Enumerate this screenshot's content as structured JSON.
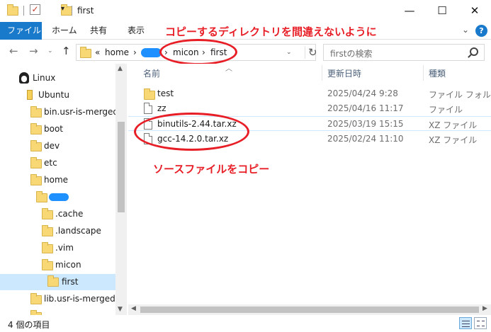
{
  "window": {
    "title": "first",
    "minimize": "—",
    "maximize": "☐",
    "close": "✕"
  },
  "ribbon": {
    "tabs": [
      "ファイル",
      "ホーム",
      "共有",
      "表示"
    ],
    "expand_icon": "chevron-down",
    "help": "?"
  },
  "annotations": {
    "copy_directory_note": "コピーするディレクトリを間違えないように",
    "copy_source_note": "ソースファイルをコピー"
  },
  "address_bar": {
    "overflow": "«",
    "crumbs": [
      "home",
      "micon",
      "first"
    ],
    "separator": "›",
    "redacted_crumb_color": "#1e90ff"
  },
  "search": {
    "placeholder": "firstの検索"
  },
  "nav_tree": [
    {
      "label": "Linux",
      "icon": "linux-icon"
    },
    {
      "label": "Ubuntu",
      "icon": "ubuntu-icon"
    },
    {
      "label": "bin.usr-is-merged",
      "icon": "folder-icon"
    },
    {
      "label": "boot",
      "icon": "folder-icon"
    },
    {
      "label": "dev",
      "icon": "folder-icon"
    },
    {
      "label": "etc",
      "icon": "folder-icon"
    },
    {
      "label": "home",
      "icon": "folder-icon"
    },
    {
      "label": "",
      "icon": "folder-icon",
      "redacted": true
    },
    {
      "label": ".cache",
      "icon": "folder-icon"
    },
    {
      "label": ".landscape",
      "icon": "folder-icon"
    },
    {
      "label": ".vim",
      "icon": "folder-icon"
    },
    {
      "label": "micon",
      "icon": "folder-icon"
    },
    {
      "label": "first",
      "icon": "folder-icon",
      "selected": true
    },
    {
      "label": "lib.usr-is-merged",
      "icon": "folder-icon"
    }
  ],
  "columns": {
    "name": "名前",
    "modified": "更新日時",
    "type": "種類"
  },
  "files": [
    {
      "name": "test",
      "modified": "2025/04/24 9:28",
      "type": "ファイル フォルダー",
      "icon": "folder-icon"
    },
    {
      "name": "zz",
      "modified": "2025/04/16 11:17",
      "type": "ファイル",
      "icon": "document-icon"
    },
    {
      "name": "binutils-2.44.tar.xz",
      "modified": "2025/03/19 15:15",
      "type": "XZ ファイル",
      "icon": "document-icon"
    },
    {
      "name": "gcc-14.2.0.tar.xz",
      "modified": "2025/02/24 11:10",
      "type": "XZ ファイル",
      "icon": "document-icon"
    }
  ],
  "status": {
    "item_count": "4 個の項目"
  },
  "colors": {
    "accent": "#1979ca",
    "annotation_red": "#e81e27",
    "selection": "#cce8ff"
  }
}
